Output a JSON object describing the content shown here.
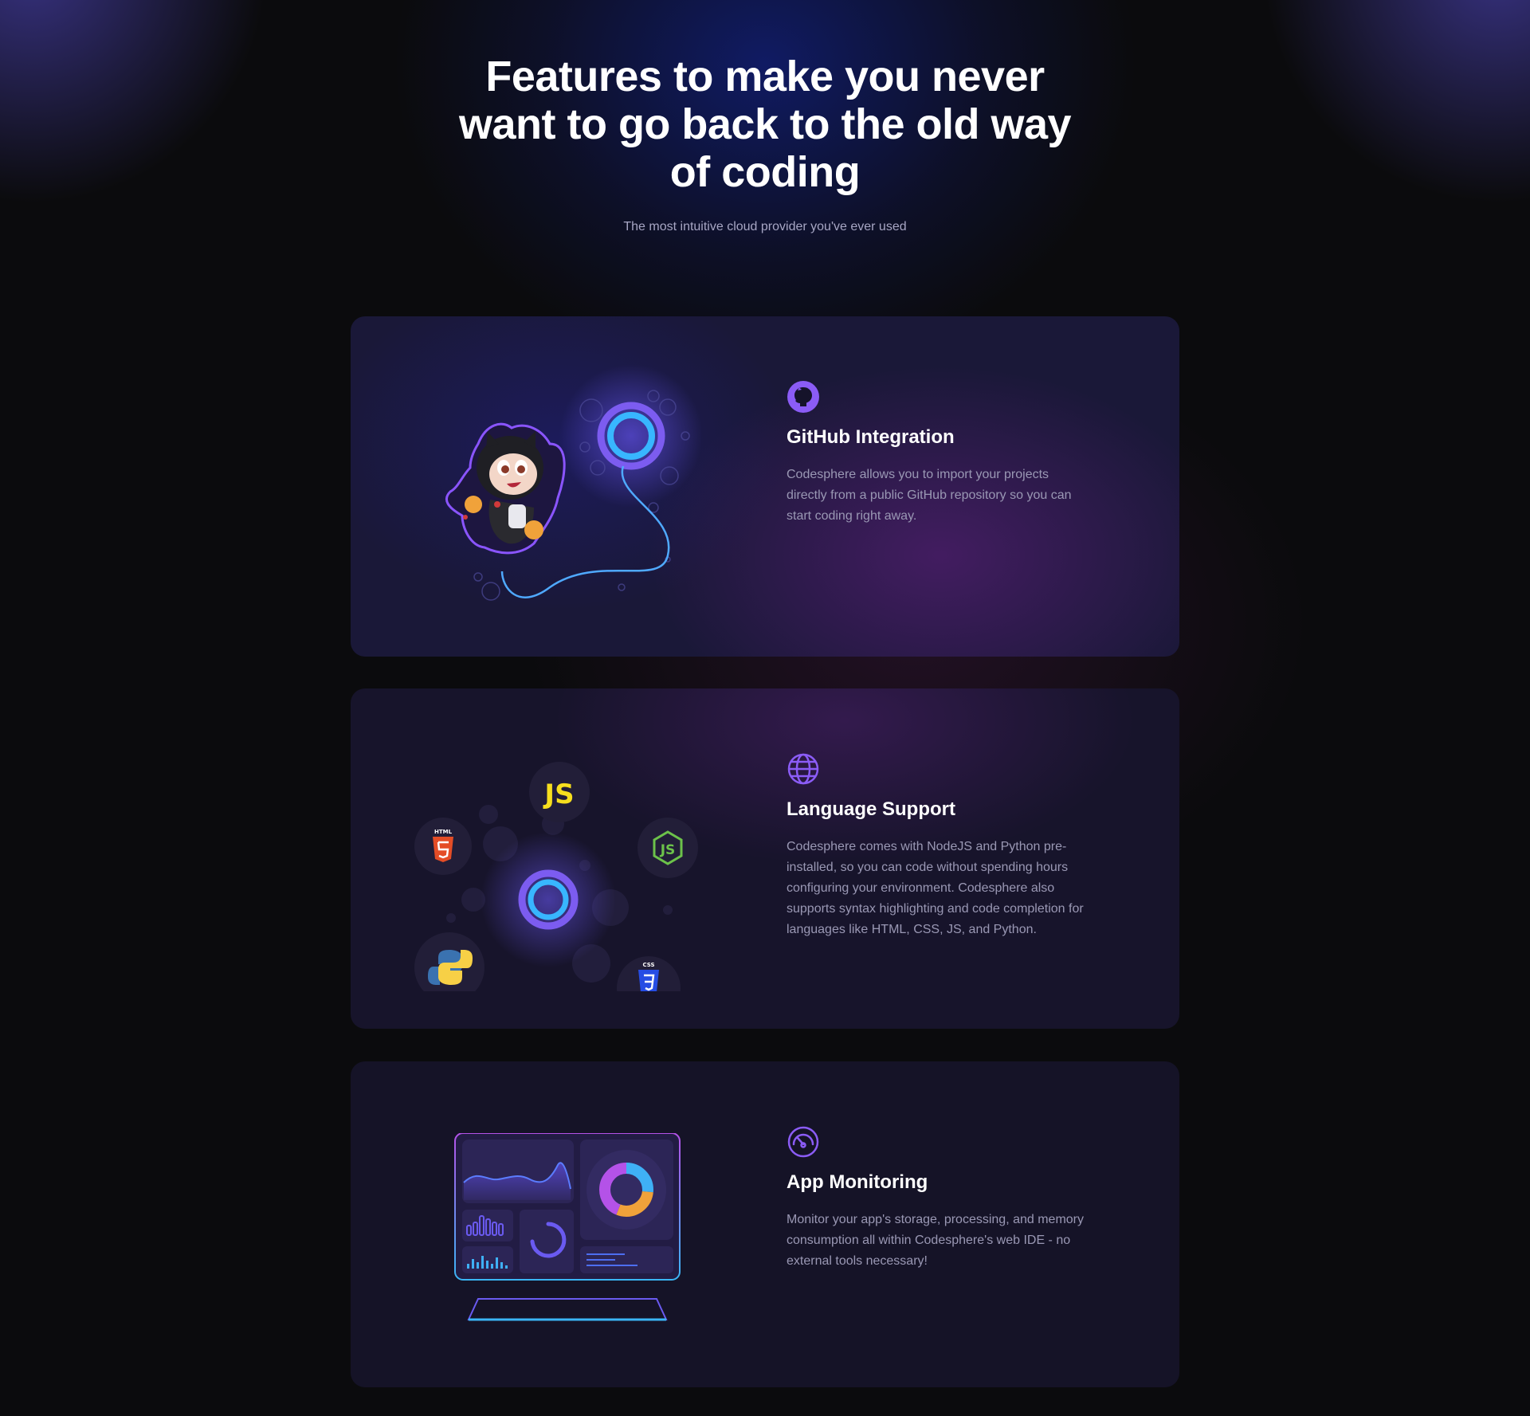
{
  "hero": {
    "title": "Features to make you never want to go back to the old way of coding",
    "subtitle": "The most intuitive cloud provider you've ever used"
  },
  "features": [
    {
      "icon": "github-icon",
      "title": "GitHub Integration",
      "description": "Codesphere allows you to import your projects directly from a public GitHub repository so you can start coding right away."
    },
    {
      "icon": "globe-icon",
      "title": "Language Support",
      "description": "Codesphere comes with NodeJS and Python pre-installed, so you can code without spending hours configuring your environment. Codesphere also supports syntax highlighting and code completion for languages like HTML, CSS, JS, and Python."
    },
    {
      "icon": "gauge-icon",
      "title": "App Monitoring",
      "description": "Monitor your app's storage, processing, and memory consumption all within Codesphere's web IDE - no external tools necessary!"
    }
  ],
  "language_badges": {
    "js": "JS",
    "html": "HTML",
    "css": "CSS"
  },
  "colors": {
    "accent_purple": "#8b5cf6",
    "accent_blue": "#38bdf8",
    "background": "#0b0b0d"
  }
}
